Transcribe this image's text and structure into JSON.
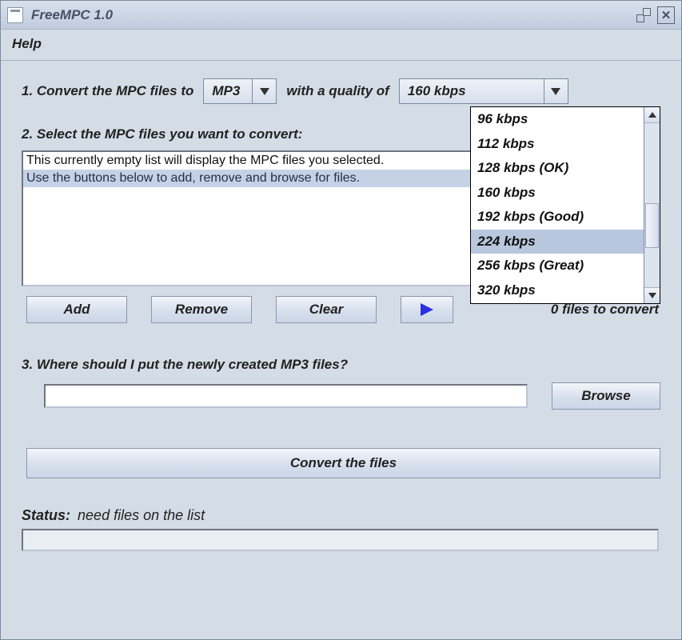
{
  "window": {
    "title": "FreeMPC 1.0"
  },
  "menubar": {
    "help": "Help"
  },
  "step1": {
    "label_a": "1. Convert the MPC files to",
    "format_selected": "MP3",
    "label_b": "with a quality of",
    "quality_selected": "160 kbps",
    "quality_options": [
      "96 kbps",
      "112 kbps",
      "128 kbps (OK)",
      "160 kbps",
      "192 kbps (Good)",
      "224 kbps",
      "256 kbps (Great)",
      "320 kbps"
    ],
    "quality_highlight_index": 5
  },
  "step2": {
    "label": "2. Select the MPC files you want to convert:",
    "placeholder_line1": "This currently empty list will display the MPC files you selected.",
    "placeholder_line2": "Use the buttons below to add, remove and browse for files."
  },
  "buttons": {
    "add": "Add",
    "remove": "Remove",
    "clear": "Clear",
    "files_count": "0 files to convert",
    "browse": "Browse",
    "convert": "Convert the files"
  },
  "step3": {
    "label": "3. Where should I put the newly created MP3 files?",
    "dest": ""
  },
  "status": {
    "label": "Status:",
    "value": "need files on the list"
  }
}
